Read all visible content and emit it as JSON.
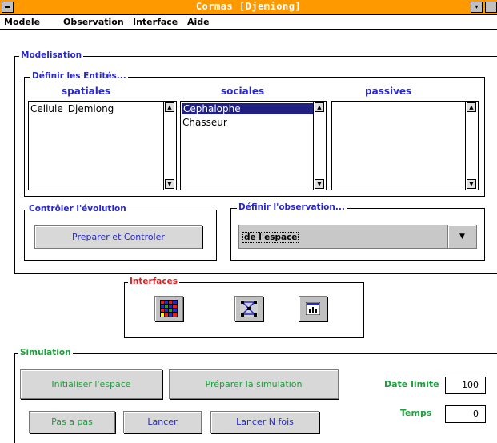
{
  "window": {
    "title": "Cormas [Djemiong]"
  },
  "menubar": {
    "items": [
      "Modele",
      "Observation",
      "Interface",
      "Aide"
    ]
  },
  "modelisation": {
    "label": "Modelisation",
    "entities": {
      "label": "Définir les Entités...",
      "columns": [
        {
          "header": "spatiales",
          "items": [
            "Cellule_Djemiong"
          ],
          "selected": -1
        },
        {
          "header": "sociales",
          "items": [
            "Cephalophe",
            "Chasseur"
          ],
          "selected": 0
        },
        {
          "header": "passives",
          "items": [],
          "selected": -1
        }
      ]
    },
    "evolution": {
      "label": "Contrôler l'évolution",
      "button": "Preparer et Controler"
    },
    "observation": {
      "label": "Définir l'observation...",
      "selected": "de l'espace"
    }
  },
  "interfaces": {
    "label": "Interfaces",
    "icons": [
      "grid-view-icon",
      "network-view-icon",
      "chart-view-icon"
    ]
  },
  "simulation": {
    "label": "Simulation",
    "buttons": {
      "init": "Initialiser l'espace",
      "prepare": "Préparer la simulation",
      "step": "Pas a pas",
      "run": "Lancer",
      "run_n": "Lancer N fois"
    },
    "date_limite": {
      "label": "Date limite",
      "value": "100"
    },
    "temps": {
      "label": "Temps",
      "value": "0"
    }
  },
  "colors": {
    "titlebar": "#ff9900",
    "group_label": "#2828c8",
    "interfaces_label": "#e02020",
    "sim_label": "#1e9e3c",
    "selection": "#202080"
  }
}
